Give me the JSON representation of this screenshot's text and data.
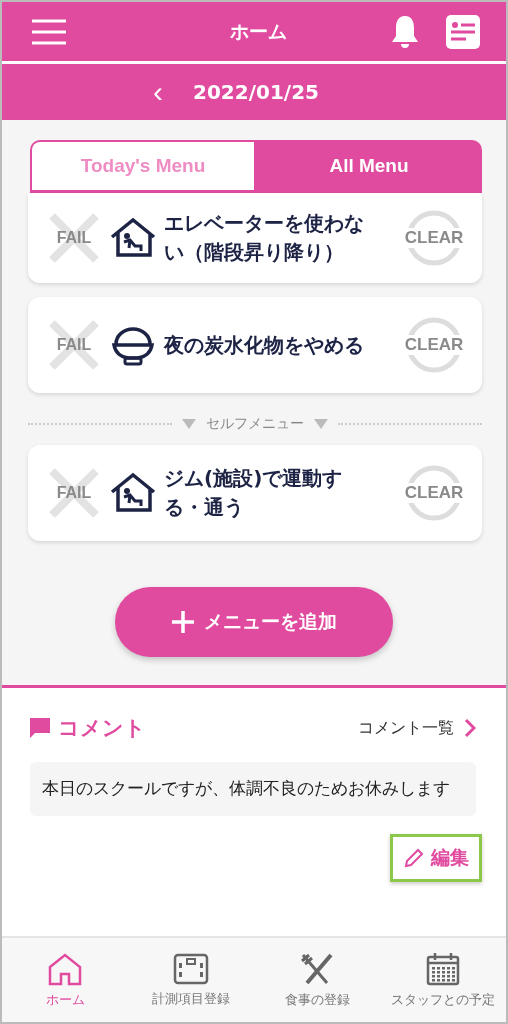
{
  "header": {
    "title": "ホーム"
  },
  "date_bar": {
    "back": "‹",
    "date": "2022/01/25"
  },
  "tabs": [
    {
      "label": "Today's Menu",
      "selected": false
    },
    {
      "label": "All Menu",
      "selected": true
    }
  ],
  "menu_items": [
    {
      "kind": "house",
      "fail": "FAIL",
      "text": "エレベーターを使わない（階段昇り降り）",
      "clear": "CLEAR"
    },
    {
      "kind": "bowl",
      "fail": "FAIL",
      "text": "夜の炭水化物をやめる",
      "clear": "CLEAR"
    },
    {
      "kind": "separator",
      "text": "セルフメニュー"
    },
    {
      "kind": "house",
      "fail": "FAIL",
      "text": "ジム(施設)で運動する・通う",
      "clear": "CLEAR"
    }
  ],
  "add_button": {
    "label": "メニューを追加"
  },
  "comment": {
    "title": "コメント",
    "list_link": "コメント一覧",
    "text": "本日のスクールですが、体調不良のためお休みします",
    "edit": {
      "label": "編集",
      "highlighted": true
    }
  },
  "bottom_nav": [
    {
      "label": "ホーム",
      "kind": "home",
      "selected": true
    },
    {
      "label": "計測項目登録",
      "kind": "scale",
      "selected": false
    },
    {
      "label": "食事の登録",
      "kind": "cutlery",
      "selected": false
    },
    {
      "label": "スタッフとの予定",
      "kind": "calendar",
      "selected": false
    }
  ]
}
